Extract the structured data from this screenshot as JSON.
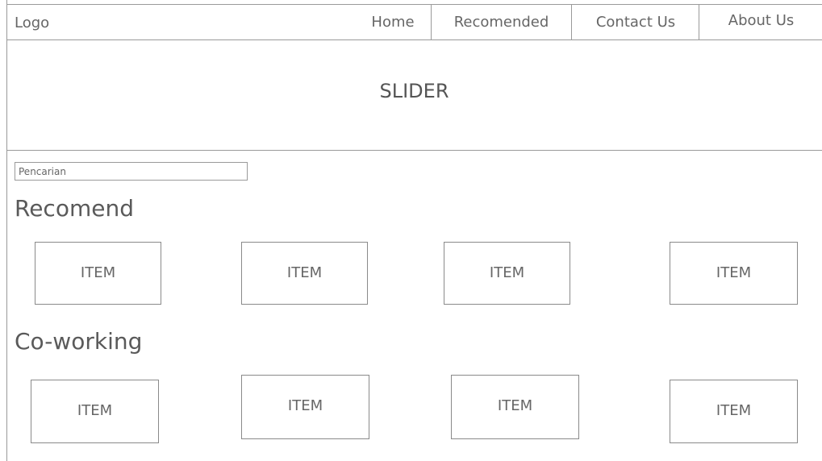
{
  "header": {
    "logo": "Logo",
    "nav": {
      "home": "Home",
      "recomended": "Recomended",
      "contact": "Contact Us",
      "about": "About Us"
    }
  },
  "slider": {
    "label": "SLIDER"
  },
  "search": {
    "placeholder": "Pencarian",
    "value": ""
  },
  "sections": {
    "recomend": {
      "title": "Recomend",
      "items": [
        "ITEM",
        "ITEM",
        "ITEM",
        "ITEM"
      ]
    },
    "coworking": {
      "title": "Co-working",
      "items": [
        "ITEM",
        "ITEM",
        "ITEM",
        "ITEM"
      ]
    }
  },
  "colors": {
    "border": "#9a9a9a",
    "text": "#5a5a5a",
    "background": "#ffffff"
  }
}
